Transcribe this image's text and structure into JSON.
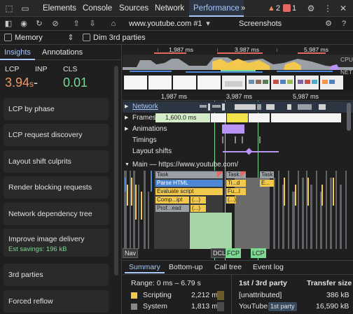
{
  "tabbar": {
    "tabs": [
      "Elements",
      "Console",
      "Sources",
      "Network",
      "Performance"
    ],
    "more": "»",
    "warnings": "2",
    "errors": "1"
  },
  "toolbar": {
    "recording": "www.youtube.com #1",
    "screenshots_label": "Screenshots",
    "memory_label": "Memory",
    "dim_label": "Dim 3rd parties"
  },
  "sidebar": {
    "tabs": [
      "Insights",
      "Annotations"
    ],
    "metrics": [
      {
        "label": "LCP",
        "value": "3.94",
        "unit": "s",
        "suffix": "-",
        "color": "#f29766"
      },
      {
        "label": "INP",
        "value": "-",
        "unit": "",
        "suffix": "",
        "color": "#e3e3e3"
      },
      {
        "label": "CLS",
        "value": "0.01",
        "unit": "",
        "suffix": "",
        "color": "#7cd992"
      }
    ],
    "cards": [
      {
        "title": "LCP by phase"
      },
      {
        "title": "LCP request discovery"
      },
      {
        "title": "Layout shift culprits"
      },
      {
        "title": "Render blocking requests"
      },
      {
        "title": "Network dependency tree"
      },
      {
        "title": "Improve image delivery",
        "sub": "Est savings: 196 kB"
      },
      {
        "title": "3rd parties"
      },
      {
        "title": "Forced reflow"
      }
    ]
  },
  "timeline": {
    "overview_ticks": [
      "1,987 ms",
      "3,987 ms",
      "5,987 ms"
    ],
    "cpu_label": "CPU",
    "net_label": "NET",
    "ruler_ticks": [
      "1,987 ms",
      "3,987 ms",
      "5,987 ms"
    ],
    "tracks": [
      {
        "label": "Network",
        "arrow": "▶",
        "highlight": true
      },
      {
        "label": "Frames",
        "arrow": "▶",
        "highlight": false
      },
      {
        "label": "Animations",
        "arrow": "▶",
        "highlight": false
      },
      {
        "label": "Timings",
        "arrow": "",
        "highlight": false
      },
      {
        "label": "Layout shifts",
        "arrow": "",
        "highlight": false
      }
    ],
    "frame_value": "1,600.0 ms",
    "main_label": "Main — https://www.youtube.com/",
    "flame_labels": {
      "task1": "Task",
      "task2": "Task",
      "task3": "Task",
      "parse_html": "Parse HTML",
      "ti": "Ti...d",
      "e": "E...",
      "eval_script": "Evaluate script",
      "fu": "Fu...l",
      "compile": "Comp...ipt",
      "dots1": "(...)",
      "dots2": "(...)",
      "prof": "Prof...ead",
      "dots3": "(...)"
    },
    "markers": [
      "Nav",
      "DCL",
      "FCP",
      "LCP"
    ]
  },
  "bottom": {
    "tabs": [
      "Summary",
      "Bottom-up",
      "Call tree",
      "Event log"
    ],
    "range": "Range: 0 ms – 6.79 s",
    "rows": [
      {
        "label": "Scripting",
        "value": "2,212 ms",
        "color": "#f2c94c"
      },
      {
        "label": "System",
        "value": "1,813 ms",
        "color": "#888888"
      }
    ],
    "party_header": "1st / 3rd party",
    "transfer_header": "Transfer size",
    "party_rows": [
      {
        "name": "[unattributed]",
        "badge": "",
        "size": "386 kB"
      },
      {
        "name": "YouTube",
        "badge": "1st party",
        "size": "16,590 kB"
      }
    ]
  }
}
